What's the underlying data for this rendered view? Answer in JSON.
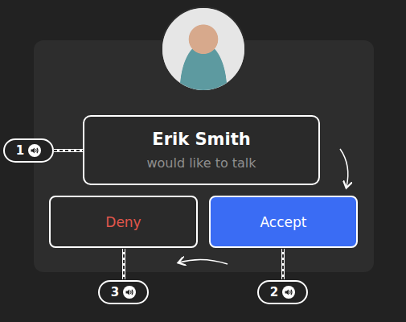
{
  "caller": {
    "name": "Erik Smith",
    "message": "would like to talk"
  },
  "buttons": [
    {
      "label": "Deny",
      "kind": "deny"
    },
    {
      "label": "Accept",
      "kind": "accept"
    }
  ],
  "annotations": [
    {
      "number": "1"
    },
    {
      "number": "2"
    },
    {
      "number": "3"
    }
  ]
}
